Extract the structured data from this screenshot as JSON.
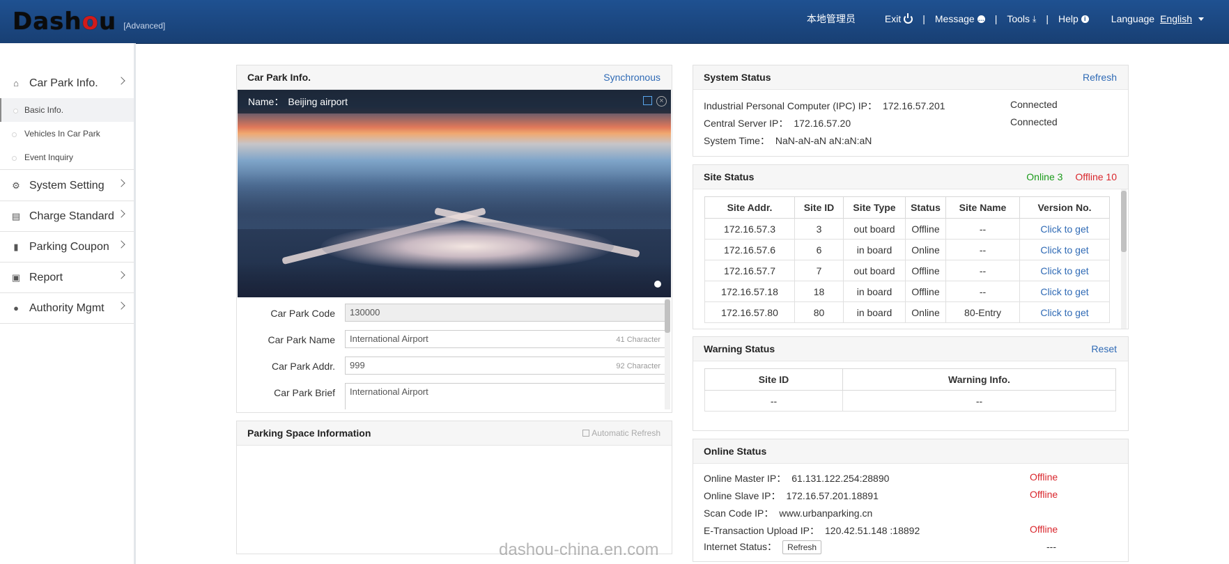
{
  "header": {
    "logo": "Dashou",
    "logo_sub": "[Advanced]",
    "user": "本地管理员",
    "exit": "Exit",
    "message": "Message",
    "tools": "Tools",
    "help": "Help",
    "language_label": "Language",
    "language_value": "English",
    "separator": "|"
  },
  "sidebar": {
    "groups": [
      {
        "label": "Car Park Info.",
        "icon": "home-icon",
        "subitems": [
          "Basic Info.",
          "Vehicles In Car Park",
          "Event Inquiry"
        ]
      },
      {
        "label": "System Setting",
        "icon": "gear-icon"
      },
      {
        "label": "Charge Standard",
        "icon": "book-icon"
      },
      {
        "label": "Parking Coupon",
        "icon": "coupon-icon"
      },
      {
        "label": "Report",
        "icon": "report-icon"
      },
      {
        "label": "Authority Mgmt",
        "icon": "lock-icon"
      }
    ]
  },
  "carpark": {
    "title": "Car Park Info.",
    "sync": "Synchronous",
    "name_label": "Name：",
    "name_value": "Beijing airport",
    "fields": [
      {
        "label": "Car Park Code",
        "value": "130000",
        "count": ""
      },
      {
        "label": "Car Park Name",
        "value": "International Airport",
        "count": "41 Character"
      },
      {
        "label": "Car Park Addr.",
        "value": "999",
        "count": "92 Character"
      },
      {
        "label": "Car Park Brief",
        "value": "International Airport",
        "count": ""
      }
    ]
  },
  "parking_space": {
    "title": "Parking Space Information",
    "auto_refresh": "Automatic Refresh"
  },
  "system_status": {
    "title": "System Status",
    "refresh": "Refresh",
    "lines": [
      {
        "label": "Industrial Personal Computer (IPC) IP：",
        "value": "172.16.57.201",
        "status": "Connected"
      },
      {
        "label": "Central Server IP：",
        "value": "172.16.57.20",
        "status": "Connected"
      },
      {
        "label": "System Time：",
        "value": "NaN-aN-aN aN:aN:aN",
        "status": ""
      }
    ]
  },
  "site_status": {
    "title": "Site Status",
    "online": "Online 3",
    "offline": "Offline 10",
    "columns": [
      "Site Addr.",
      "Site ID",
      "Site Type",
      "Status",
      "Site Name",
      "Version No."
    ],
    "rows": [
      [
        "172.16.57.3",
        "3",
        "out board",
        "Offline",
        "--",
        "Click to get"
      ],
      [
        "172.16.57.6",
        "6",
        "in board",
        "Online",
        "--",
        "Click to get"
      ],
      [
        "172.16.57.7",
        "7",
        "out board",
        "Offline",
        "--",
        "Click to get"
      ],
      [
        "172.16.57.18",
        "18",
        "in board",
        "Offline",
        "--",
        "Click to get"
      ],
      [
        "172.16.57.80",
        "80",
        "in board",
        "Online",
        "80-Entry",
        "Click to get"
      ]
    ]
  },
  "warning_status": {
    "title": "Warning Status",
    "reset": "Reset",
    "columns": [
      "Site ID",
      "Warning Info."
    ],
    "rows": [
      [
        "--",
        "--"
      ]
    ]
  },
  "online_status": {
    "title": "Online Status",
    "lines": [
      {
        "label": "Online Master IP：",
        "value": "61.131.122.254:28890",
        "status": "Offline"
      },
      {
        "label": "Online Slave IP：",
        "value": "172.16.57.201.18891",
        "status": "Offline"
      },
      {
        "label": "Scan Code IP：",
        "value": "www.urbanparking.cn",
        "status": ""
      },
      {
        "label": "E-Transaction Upload IP：",
        "value": "120.42.51.148 :18892",
        "status": "Offline"
      }
    ],
    "internet_label": "Internet Status：",
    "internet_button": "Refresh",
    "internet_value": "---"
  },
  "watermark": "dashou-china.en.com"
}
